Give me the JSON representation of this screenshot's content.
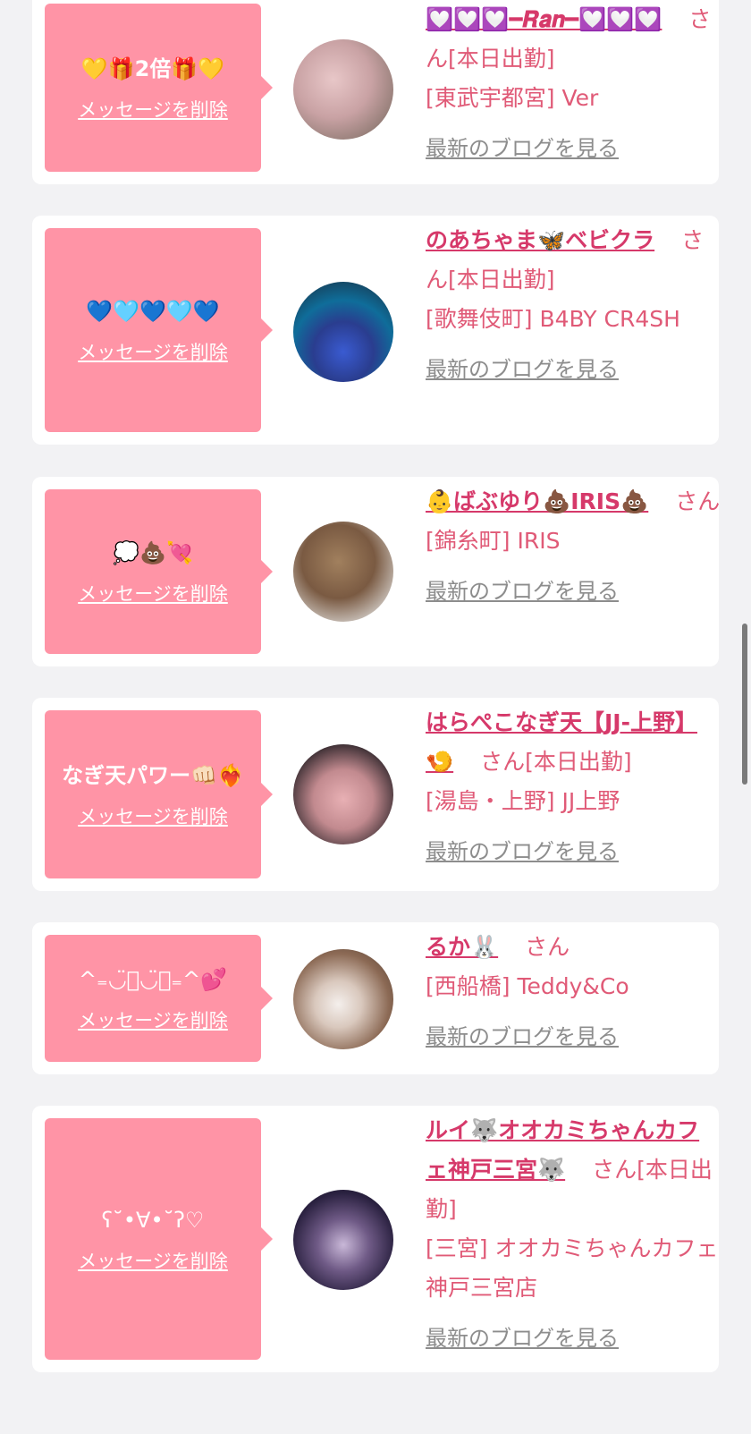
{
  "delete_label": "メッセージを削除",
  "blog_label": "最新のブログを見る",
  "suffix_san": "さん",
  "cards": [
    {
      "message": "💛🎁2倍🎁💛",
      "name": "💟💟💟━𝑹𝒂𝒏━💟💟💟",
      "status": "[本日出勤]",
      "shop": "[東武宇都宮] Ver"
    },
    {
      "message": "💙🩵💙🩵💙",
      "name": "のあちゃま🦋ベビクラ",
      "status": "[本日出勤]",
      "shop": "[歌舞伎町] B4BY CR4SH"
    },
    {
      "message": "💭💩💘",
      "name": "👶ばぶゆり💩IRIS💩",
      "status": "",
      "shop": "[錦糸町] IRIS"
    },
    {
      "message": "なぎ天パワー👊🏻❤️‍🔥",
      "name": "はらぺこなぎ天【JJ-上野】🍤",
      "status": "[本日出勤]",
      "shop": "[湯島・上野] JJ上野"
    },
    {
      "message": "^₌◡̈⃝◡̈⃝₌^💕",
      "name": "るか🐰",
      "status": "",
      "shop": "[西船橋] Teddy&Co"
    },
    {
      "message": "ʕ˘•∀•˘ʔ♡",
      "name": "ルイ🐺オオカミちゃんカフェ神戸三宮🐺",
      "status": "[本日出勤]",
      "shop": "[三宮] オオカミちゃんカフェ神戸三宮店"
    }
  ],
  "colors": {
    "bubble": "#ff94a6",
    "name": "#d6396a",
    "text": "#e05a77",
    "link_gray": "#8d8d8d",
    "background": "#f2f2f4"
  }
}
